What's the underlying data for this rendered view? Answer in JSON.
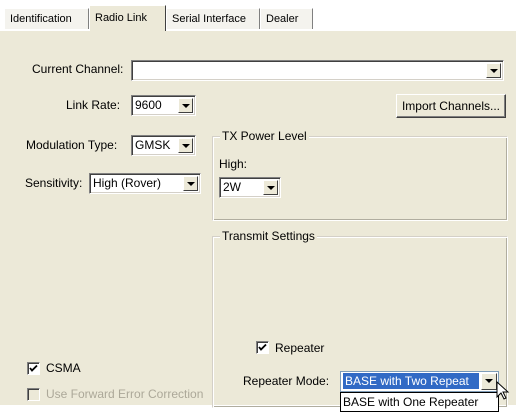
{
  "tabs": [
    {
      "label": "Identification"
    },
    {
      "label": "Radio Link"
    },
    {
      "label": "Serial Interface"
    },
    {
      "label": "Dealer"
    }
  ],
  "radio_link": {
    "current_channel": {
      "label": "Current Channel:",
      "value": ""
    },
    "link_rate": {
      "label": "Link Rate:",
      "value": "9600"
    },
    "modulation_type": {
      "label": "Modulation Type:",
      "value": "GMSK"
    },
    "sensitivity": {
      "label": "Sensitivity:",
      "value": "High (Rover)"
    },
    "import_channels_label": "Import Channels...",
    "tx_power": {
      "group_label": "TX Power Level",
      "level_label": "High:",
      "value": "2W"
    },
    "transmit_settings": {
      "group_label": "Transmit Settings",
      "repeater_label": "Repeater",
      "repeater_checked": true,
      "repeater_mode_label": "Repeater Mode:",
      "repeater_mode_value": "BASE with Two Repeat",
      "dropdown_option": "BASE with One Repeater"
    },
    "csma": {
      "label": "CSMA",
      "checked": true
    },
    "fec": {
      "label": "Use Forward Error Correction",
      "checked": false,
      "enabled": false
    }
  },
  "colors": {
    "panel": "#ece9d8",
    "selection": "#316ac5",
    "disabled_text": "#aca899"
  }
}
